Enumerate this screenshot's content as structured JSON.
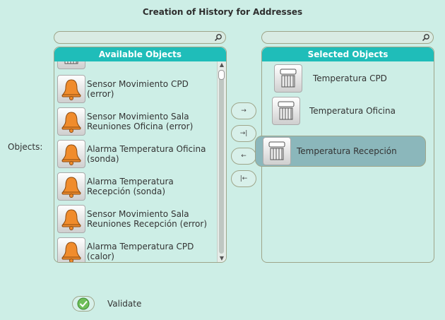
{
  "dialog": {
    "title": "Creation of History for Addresses",
    "objects_label": "Objects:"
  },
  "available": {
    "header": "Available Objects",
    "search_value": "",
    "items": [
      {
        "label": "Sensor Movimiento CPD (error)",
        "icon": "bell-icon"
      },
      {
        "label": "Sensor Movimiento Sala Reuniones Oficina (error)",
        "icon": "bell-icon"
      },
      {
        "label": "Alarma Temperatura Oficina (sonda)",
        "icon": "bell-icon"
      },
      {
        "label": "Alarma Temperatura Recepción (sonda)",
        "icon": "bell-icon"
      },
      {
        "label": "Sensor Movimiento Sala Reuniones Recepción (error)",
        "icon": "bell-icon"
      },
      {
        "label": "Alarma Temperatura CPD (calor)",
        "icon": "bell-icon"
      }
    ],
    "partial_top_icon": "heater-icon"
  },
  "selected": {
    "header": "Selected Objects",
    "search_value": "",
    "items": [
      {
        "label": "Temperatura CPD",
        "icon": "heater-icon",
        "selected": false
      },
      {
        "label": "Temperatura Oficina",
        "icon": "heater-icon",
        "selected": false
      },
      {
        "label": "Temperatura Recepción",
        "icon": "heater-icon",
        "selected": true
      }
    ]
  },
  "transfer_buttons": [
    {
      "name": "add-button",
      "glyph": "→"
    },
    {
      "name": "add-all-button",
      "glyph": "→|"
    },
    {
      "name": "remove-button",
      "glyph": "←"
    },
    {
      "name": "remove-all-button",
      "glyph": "|←"
    }
  ],
  "validate": {
    "label": "Validate"
  },
  "colors": {
    "background": "#cdeee6",
    "header": "#1fbdb9",
    "selected_row": "#8bb7bb",
    "bell": "#f08c2c",
    "check": "#4a9e3c"
  }
}
